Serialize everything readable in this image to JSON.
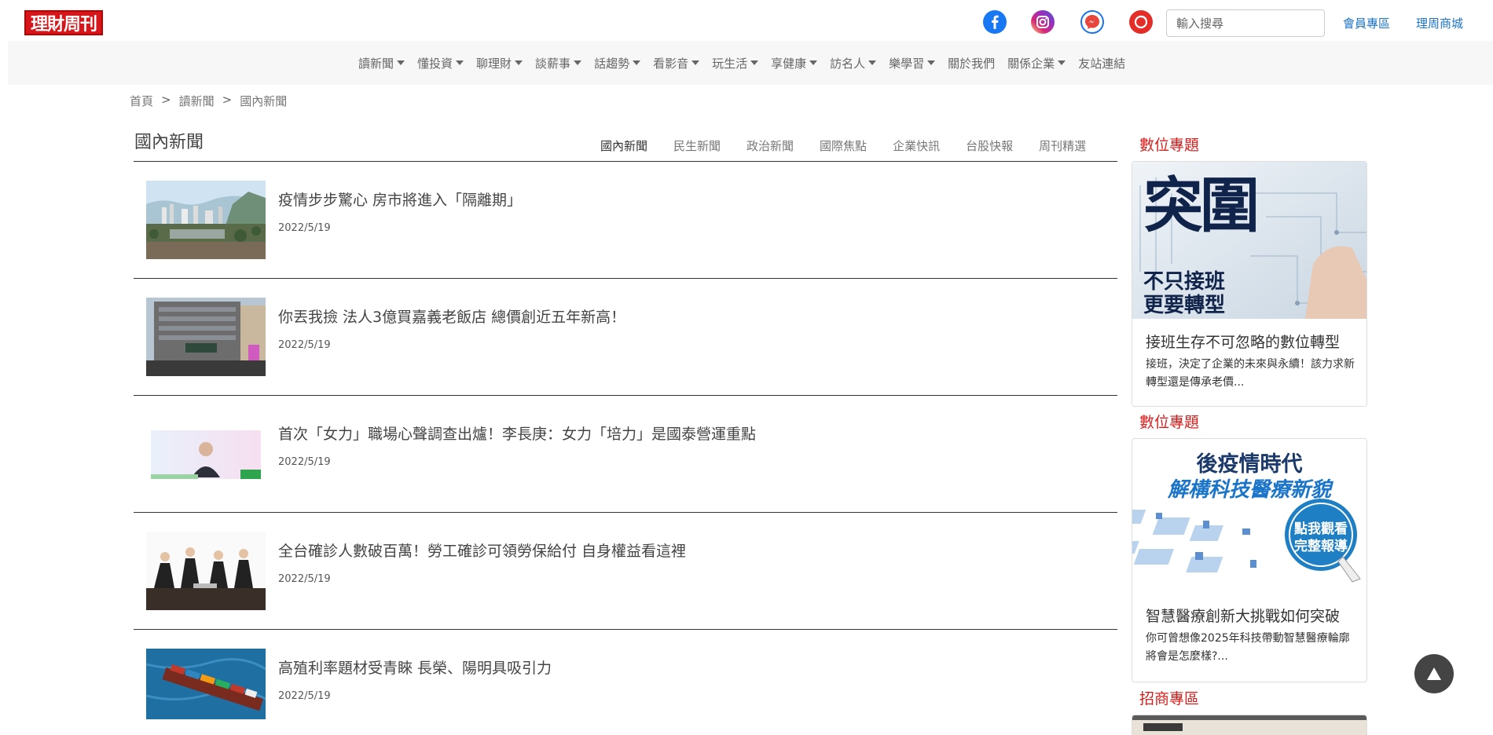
{
  "brand": {
    "logo_text": "理財周刊"
  },
  "header": {
    "social_icons": [
      "facebook-icon",
      "instagram-icon",
      "messenger-icon",
      "line-icon"
    ],
    "search_placeholder": "輸入搜尋",
    "member_link": "會員專區",
    "shop_link": "理周商城"
  },
  "nav": {
    "items": [
      {
        "label": "讀新聞",
        "dropdown": true
      },
      {
        "label": "懂投資",
        "dropdown": true
      },
      {
        "label": "聊理財",
        "dropdown": true
      },
      {
        "label": "談薪事",
        "dropdown": true
      },
      {
        "label": "話趨勢",
        "dropdown": true
      },
      {
        "label": "看影音",
        "dropdown": true
      },
      {
        "label": "玩生活",
        "dropdown": true
      },
      {
        "label": "享健康",
        "dropdown": true
      },
      {
        "label": "訪名人",
        "dropdown": true
      },
      {
        "label": "樂學習",
        "dropdown": true
      },
      {
        "label": "關於我們",
        "dropdown": false
      },
      {
        "label": "關係企業",
        "dropdown": true
      },
      {
        "label": "友站連結",
        "dropdown": false
      }
    ]
  },
  "breadcrumb": {
    "home": "首頁",
    "sep": ">",
    "level1": "讀新聞",
    "level2": "國內新聞"
  },
  "main": {
    "title": "國內新聞",
    "tabs": [
      "國內新聞",
      "民生新聞",
      "政治新聞",
      "國際焦點",
      "企業快訊",
      "台股快報",
      "周刊精選"
    ],
    "active_tab": "國內新聞",
    "articles": [
      {
        "title": "疫情步步驚心  房市將進入「隔離期」",
        "date": "2022/5/19",
        "thumb": "city-skyline-image"
      },
      {
        "title": "你丟我撿 法人3億買嘉義老飯店 總價創近五年新高！",
        "date": "2022/5/19",
        "thumb": "hotel-building-image"
      },
      {
        "title": "首次「女力」職場心聲調查出爐！李長庚：女力「培力」是國泰營運重點",
        "date": "2022/5/19",
        "thumb": "speaker-video-image"
      },
      {
        "title": "全台確診人數破百萬！勞工確診可領勞保給付 自身權益看這裡",
        "date": "2022/5/19",
        "thumb": "business-meeting-image"
      },
      {
        "title": "高殖利率題材受青睞 長榮、陽明具吸引力",
        "date": "2022/5/19",
        "thumb": "container-ship-image"
      }
    ]
  },
  "sidebar": {
    "cards": [
      {
        "heading": "數位專題",
        "banner_big": "突圍",
        "banner_line1": "不只接班",
        "banner_line2": "更要轉型",
        "title": "接班生存不可忽略的數位轉型",
        "desc": "接班，決定了企業的未來與永續！該力求新轉型還是傳承老價..."
      },
      {
        "heading": "數位專題",
        "banner_line1": "後疫情時代",
        "banner_line2": "解構科技醫療新貌",
        "banner_badge_1": "點我觀看",
        "banner_badge_2": "完整報導",
        "title": "智慧醫療創新大挑戰如何突破",
        "desc": "你可曾想像2025年科技帶動智慧醫療輪廓將會是怎麼樣?..."
      },
      {
        "heading": "招商專區"
      }
    ]
  },
  "back_to_top_icon": "arrow-up-icon"
}
